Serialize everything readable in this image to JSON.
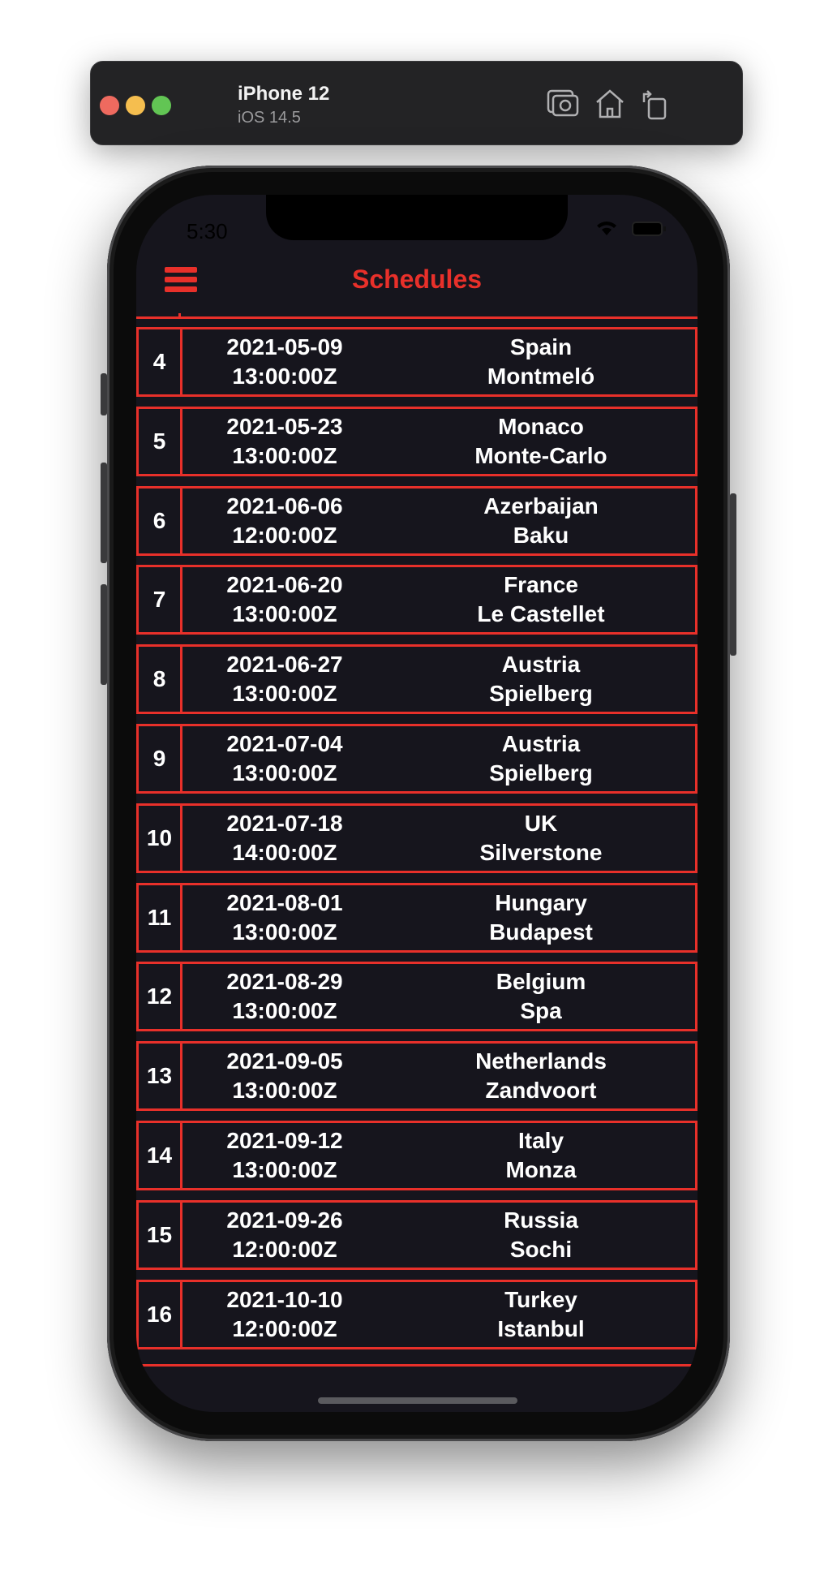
{
  "simulator": {
    "device": "iPhone 12",
    "os": "iOS 14.5",
    "buttons": [
      "camera-icon",
      "home-icon",
      "rotate-icon"
    ]
  },
  "status_bar": {
    "time": "5:30"
  },
  "nav": {
    "title": "Schedules",
    "menu_icon": "hamburger-icon"
  },
  "colors": {
    "accent": "#e8302a",
    "background": "#16151d"
  },
  "races": [
    {
      "round": "4",
      "date": "2021-05-09",
      "time": "13:00:00Z",
      "country": "Spain",
      "locality": "Montmeló"
    },
    {
      "round": "5",
      "date": "2021-05-23",
      "time": "13:00:00Z",
      "country": "Monaco",
      "locality": "Monte-Carlo"
    },
    {
      "round": "6",
      "date": "2021-06-06",
      "time": "12:00:00Z",
      "country": "Azerbaijan",
      "locality": "Baku"
    },
    {
      "round": "7",
      "date": "2021-06-20",
      "time": "13:00:00Z",
      "country": "France",
      "locality": "Le Castellet"
    },
    {
      "round": "8",
      "date": "2021-06-27",
      "time": "13:00:00Z",
      "country": "Austria",
      "locality": "Spielberg"
    },
    {
      "round": "9",
      "date": "2021-07-04",
      "time": "13:00:00Z",
      "country": "Austria",
      "locality": "Spielberg"
    },
    {
      "round": "10",
      "date": "2021-07-18",
      "time": "14:00:00Z",
      "country": "UK",
      "locality": "Silverstone"
    },
    {
      "round": "11",
      "date": "2021-08-01",
      "time": "13:00:00Z",
      "country": "Hungary",
      "locality": "Budapest"
    },
    {
      "round": "12",
      "date": "2021-08-29",
      "time": "13:00:00Z",
      "country": "Belgium",
      "locality": "Spa"
    },
    {
      "round": "13",
      "date": "2021-09-05",
      "time": "13:00:00Z",
      "country": "Netherlands",
      "locality": "Zandvoort"
    },
    {
      "round": "14",
      "date": "2021-09-12",
      "time": "13:00:00Z",
      "country": "Italy",
      "locality": "Monza"
    },
    {
      "round": "15",
      "date": "2021-09-26",
      "time": "12:00:00Z",
      "country": "Russia",
      "locality": "Sochi"
    },
    {
      "round": "16",
      "date": "2021-10-10",
      "time": "12:00:00Z",
      "country": "Turkey",
      "locality": "Istanbul"
    }
  ]
}
